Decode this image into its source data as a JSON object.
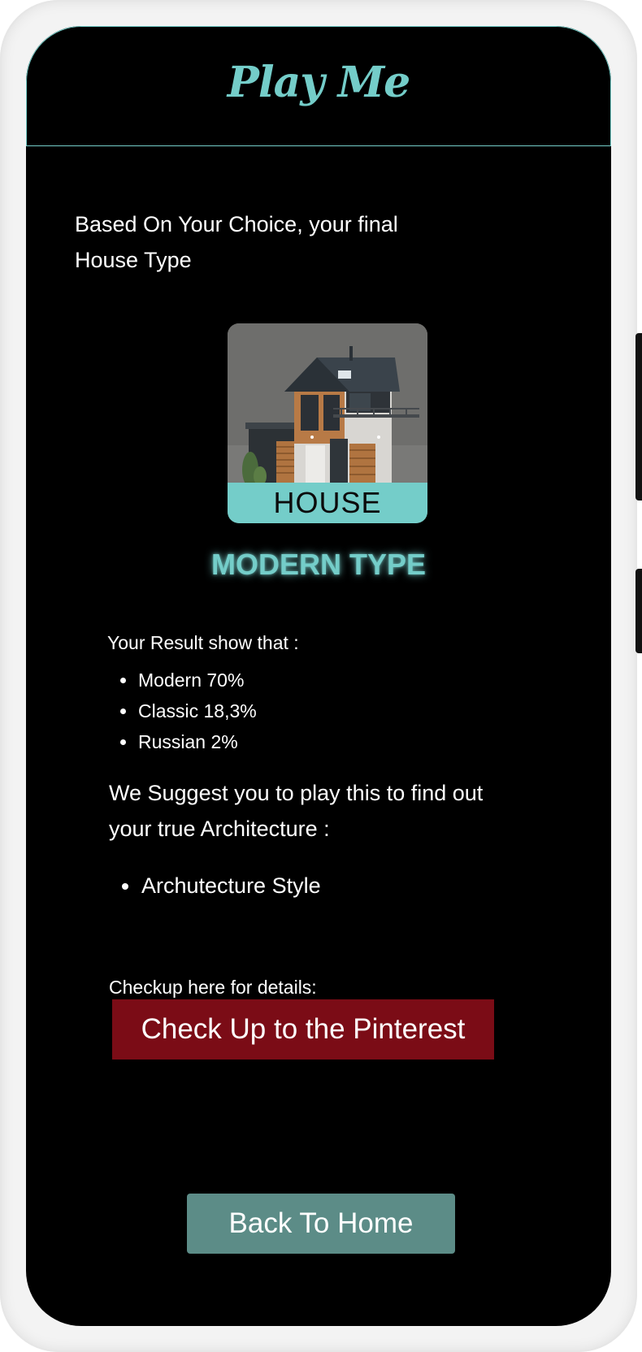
{
  "header": {
    "title": "Play Me"
  },
  "intro": {
    "line1": "Based On Your Choice, your final",
    "line2": "House Type"
  },
  "house_card": {
    "caption": "HOUSE",
    "image_icon": "house-illustration"
  },
  "result_type": "MODERN TYPE",
  "results": {
    "label": "Your Result show that :",
    "items": [
      {
        "label": "Modern 70%"
      },
      {
        "label": "Classic 18,3%"
      },
      {
        "label": "Russian 2%"
      }
    ]
  },
  "suggestion": {
    "line1": "We Suggest you to play this to find out",
    "line2": "your true Architecture :",
    "items": [
      {
        "label": "Archutecture Style"
      }
    ]
  },
  "checkup": {
    "label": "Checkup here for details:",
    "button_label": "Check Up to the Pinterest"
  },
  "home_button_label": "Back To Home",
  "colors": {
    "accent": "#74cdc9",
    "pinterest_button": "#7b0c16",
    "home_button": "#5c8c87",
    "background": "#000000"
  }
}
